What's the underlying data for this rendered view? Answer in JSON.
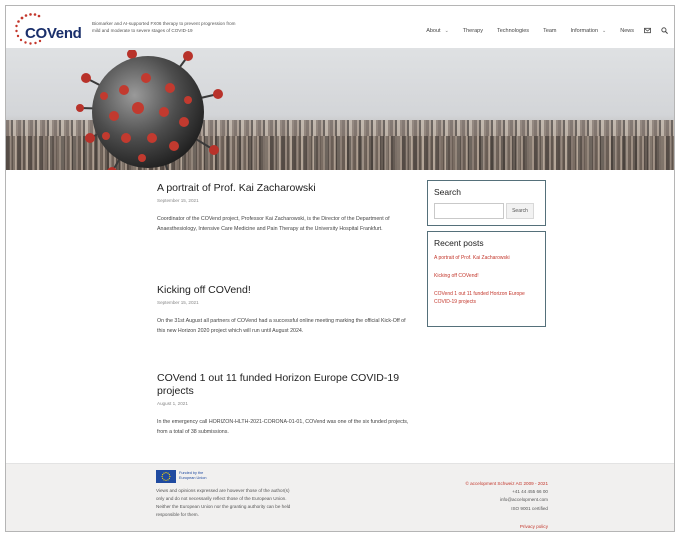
{
  "header": {
    "logo_text": "COVend",
    "tagline": "Biomarker and AI-supported FX06 therapy to prevent progression from mild and moderate to severe stages of COVID-19",
    "nav": [
      {
        "label": "About",
        "has_dropdown": true
      },
      {
        "label": "Therapy",
        "has_dropdown": false
      },
      {
        "label": "Technologies",
        "has_dropdown": false
      },
      {
        "label": "Team",
        "has_dropdown": false
      },
      {
        "label": "Information",
        "has_dropdown": true
      },
      {
        "label": "News",
        "has_dropdown": false
      }
    ],
    "icons": [
      "mail-icon",
      "search-icon"
    ]
  },
  "posts": [
    {
      "title": "A portrait of Prof. Kai Zacharowski",
      "date": "September 15, 2021",
      "excerpt": "Coordinator of the COVend project, Professor Kai Zacharowski, is the Director of the Department of Anaesthesiology, Intensive Care Medicine and Pain Therapy at the University Hospital Frankfurt."
    },
    {
      "title": "Kicking off COVend!",
      "date": "September 15, 2021",
      "excerpt": "On the 31st August all partners of COVend had a successful online meeting marking the official Kick-Off of this new Horizon 2020 project which will run until August 2024."
    },
    {
      "title": "COVend 1 out 11 funded Horizon Europe COVID-19 projects",
      "date": "August 1, 2021",
      "excerpt": "In the emergency call HORIZON-HLTH-2021-CORONA-01-01, COVend was one of the six funded projects, from a total of 38 submissions."
    }
  ],
  "sidebar": {
    "search_title": "Search",
    "search_placeholder": "",
    "search_button": "Search",
    "recent_title": "Recent posts",
    "recent_posts": [
      "A portrait of Prof. Kai Zacharowski",
      "Kicking off COVend!",
      "COVend 1 out 11 funded Horizon Europe COVID-19 projects"
    ]
  },
  "footer": {
    "eu_funded": "Funded by the European Union",
    "disclaimer": "Views and opinions expressed are however those of the author(s) only and do not necessarily reflect those of the European Union. Neither the European Union nor the granting authority can be held responsible for them.",
    "copyright": "© accelopment Schweiz AG 2009 - 2021",
    "phone": "+41 44 455 66 00",
    "email": "info@accelopment.com",
    "iso": "ISO 9001 certified",
    "privacy": "Privacy policy"
  },
  "colors": {
    "accent_red": "#c3362b",
    "logo_blue": "#1a2f6b",
    "sidebar_border": "#55707a",
    "eu_blue": "#1f4aa0"
  }
}
